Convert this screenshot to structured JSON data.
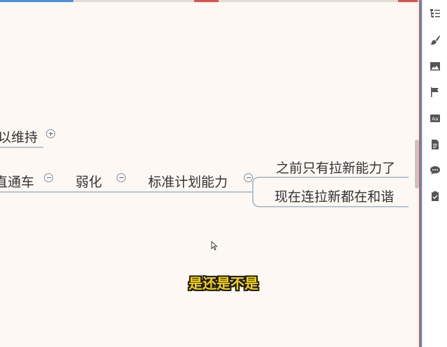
{
  "mindmap": {
    "nodes": {
      "maintain": "以维持",
      "through_car": "直通车",
      "weaken": "弱化",
      "standard_plan": "标准计划能力",
      "child_1": "之前只有拉新能力了",
      "child_2": "现在连拉新都在和谐"
    }
  },
  "subtitle": {
    "text": "是还是不是"
  },
  "sidebar": {
    "buttons": [
      {
        "icon": "outline-icon"
      },
      {
        "icon": "brush-icon"
      },
      {
        "icon": "image-icon"
      },
      {
        "icon": "flag-icon"
      },
      {
        "icon": "text-style-icon"
      },
      {
        "icon": "document-icon"
      },
      {
        "icon": "comment-icon"
      },
      {
        "icon": "clipboard-icon"
      }
    ]
  },
  "colors": {
    "canvas_background": "#fdf8f3",
    "connector_line": "#9fb3c8",
    "subtitle_fill": "#f7d200",
    "accent_red": "#d9534f",
    "accent_blue": "#4a90d9"
  }
}
